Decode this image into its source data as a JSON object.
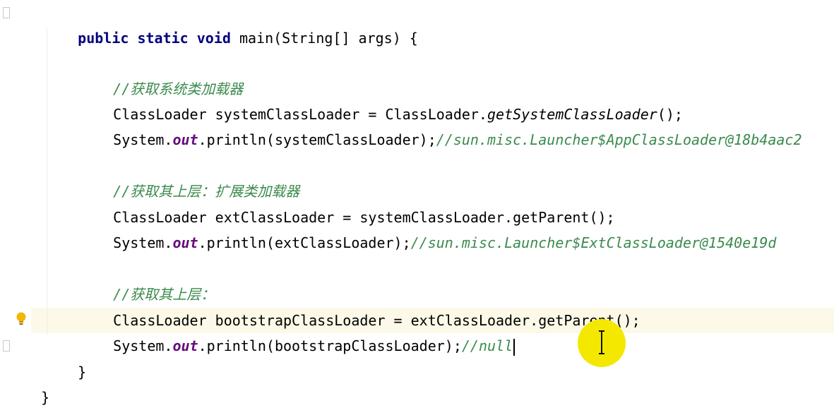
{
  "editor": {
    "lines": [
      {
        "parts": [
          {
            "t": "public static void",
            "c": "kw"
          },
          {
            "t": " main(String[] args) {",
            "c": ""
          }
        ]
      },
      {
        "parts": [
          {
            "t": "//",
            "c": "comment"
          },
          {
            "t": "获取系统类加载器",
            "c": "comment cjk"
          }
        ]
      },
      {
        "parts": [
          {
            "t": "ClassLoader systemClassLoader = ClassLoader.",
            "c": ""
          },
          {
            "t": "getSystemClassLoader",
            "c": "static-call"
          },
          {
            "t": "();",
            "c": ""
          }
        ]
      },
      {
        "parts": [
          {
            "t": "System.",
            "c": ""
          },
          {
            "t": "out",
            "c": "field"
          },
          {
            "t": ".println(systemClassLoader);",
            "c": ""
          },
          {
            "t": "//sun.misc.Launcher$AppClassLoader@18b4aac2",
            "c": "comment"
          }
        ]
      },
      {
        "parts": [
          {
            "t": "//",
            "c": "comment"
          },
          {
            "t": "获取其上层：扩展类加载器",
            "c": "comment cjk"
          }
        ]
      },
      {
        "parts": [
          {
            "t": "ClassLoader extClassLoader = systemClassLoader.getParent();",
            "c": ""
          }
        ]
      },
      {
        "parts": [
          {
            "t": "System.",
            "c": ""
          },
          {
            "t": "out",
            "c": "field"
          },
          {
            "t": ".println(extClassLoader);",
            "c": ""
          },
          {
            "t": "//sun.misc.Launcher$ExtClassLoader@1540e19d",
            "c": "comment"
          }
        ]
      },
      {
        "parts": [
          {
            "t": "//",
            "c": "comment"
          },
          {
            "t": "获取其上层：",
            "c": "comment cjk"
          }
        ]
      },
      {
        "parts": [
          {
            "t": "ClassLoader bootstrapClassLoader = extClassLoader.getParent();",
            "c": ""
          }
        ]
      },
      {
        "parts": [
          {
            "t": "System.",
            "c": ""
          },
          {
            "t": "out",
            "c": "field"
          },
          {
            "t": ".println(bootstrapClassLoader);",
            "c": ""
          },
          {
            "t": "//null",
            "c": "comment"
          }
        ]
      },
      {
        "parts": [
          {
            "t": "}",
            "c": ""
          }
        ]
      },
      {
        "parts": [
          {
            "t": "}",
            "c": ""
          }
        ]
      }
    ]
  },
  "colors": {
    "keyword": "#000080",
    "field": "#660e7a",
    "comment": "#3a8a4c",
    "current_line": "#fdf9e8",
    "cursor_highlight": "#f5e800",
    "bulb": "#f2b705"
  },
  "icons": {
    "gutter": "lightbulb-icon",
    "pointer": "text-cursor-icon",
    "fold": "fold-marker-icon"
  }
}
